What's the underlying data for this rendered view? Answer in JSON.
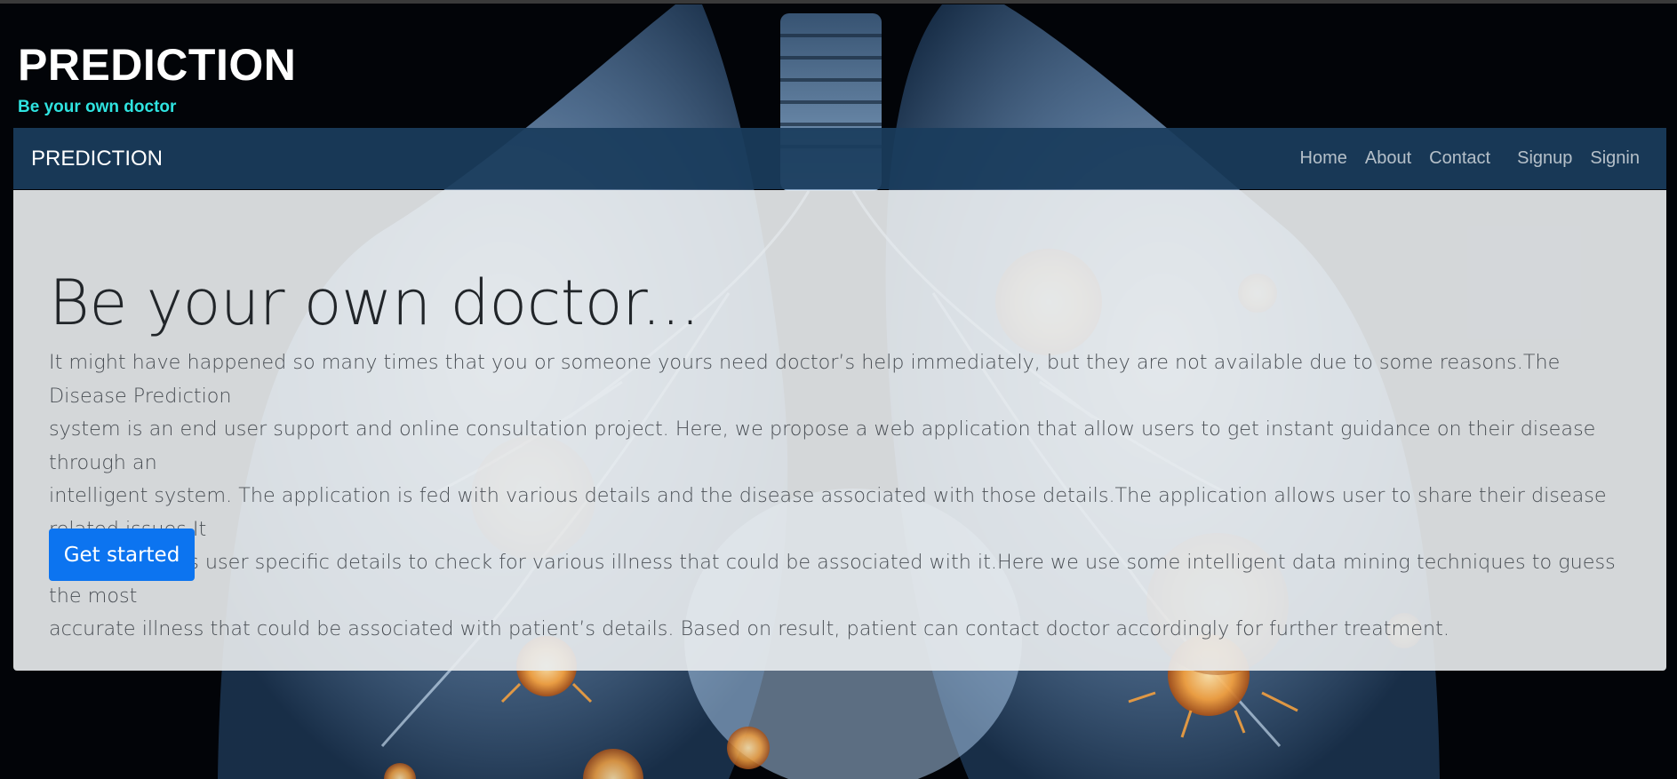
{
  "header": {
    "title": "PREDICTION",
    "tagline": "Be your own doctor"
  },
  "navbar": {
    "brand": "PREDICTION",
    "links": [
      "Home",
      "About",
      "Contact",
      "Signup",
      "Signin"
    ],
    "background": "#1a3c5c"
  },
  "hero": {
    "heading": "Be your own doctor...",
    "lead_lines": [
      "It might have happened so many times that you or someone yours need doctor’s help immediately, but they are not available due to some reasons.The Disease Prediction",
      "system is an end user support and online consultation project. Here, we propose a web application that allow users to get instant guidance on their disease through an",
      "intelligent system. The application is fed with various details and the disease associated with those details.The application allows user to share their disease related issues.It",
      "then processes user specific details to check for various illness that could be associated with it.Here we use some intelligent data mining techniques to guess the most",
      "accurate illness that could be associated with patient’s details. Based on result, patient can contact doctor accordingly for further treatment."
    ],
    "button_label": "Get started"
  },
  "colors": {
    "accent_cyan": "#2fe3e0",
    "primary_button": "#0c74f0",
    "jumbotron_bg": "#e9ecef"
  },
  "background_image": "lungs-with-virus-illustration"
}
